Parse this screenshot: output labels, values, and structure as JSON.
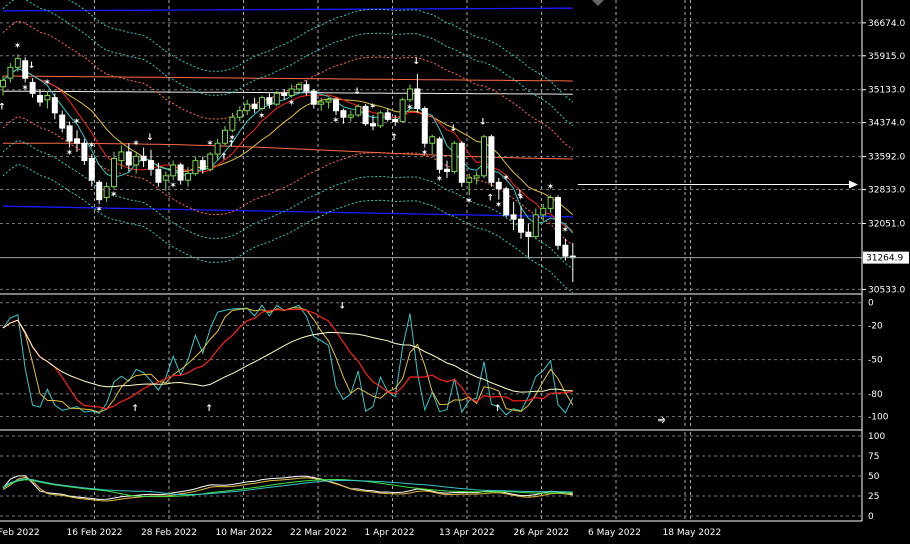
{
  "chart_data": {
    "type": "candlestick",
    "main": {
      "y_labels": [
        {
          "label": "36674.0",
          "value": 36674.0
        },
        {
          "label": "35915.0",
          "value": 35915.0
        },
        {
          "label": "35133.0",
          "value": 35133.0
        },
        {
          "label": "34374.0",
          "value": 34374.0
        },
        {
          "label": "33592.0",
          "value": 33592.0
        },
        {
          "label": "32833.0",
          "value": 32833.0
        },
        {
          "label": "32051.0",
          "value": 32051.0
        },
        {
          "label": "30533.0",
          "value": 30533.0
        }
      ],
      "current_price": {
        "label": "31264.9",
        "value": 31264.9
      },
      "ylim": [
        30450,
        37200
      ],
      "candles": [
        {
          "d": "2022-02-01",
          "o": 35200,
          "h": 35450,
          "l": 35000,
          "c": 35350
        },
        {
          "d": "2022-02-02",
          "o": 35400,
          "h": 35750,
          "l": 35300,
          "c": 35650
        },
        {
          "d": "2022-02-03",
          "o": 35650,
          "h": 35950,
          "l": 35550,
          "c": 35850
        },
        {
          "d": "2022-02-04",
          "o": 35800,
          "h": 35880,
          "l": 35300,
          "c": 35400
        },
        {
          "d": "2022-02-07",
          "o": 35300,
          "h": 35400,
          "l": 34950,
          "c": 35050
        },
        {
          "d": "2022-02-08",
          "o": 35000,
          "h": 35150,
          "l": 34750,
          "c": 34850
        },
        {
          "d": "2022-02-09",
          "o": 34900,
          "h": 35100,
          "l": 34700,
          "c": 35000
        },
        {
          "d": "2022-02-10",
          "o": 34950,
          "h": 35050,
          "l": 34450,
          "c": 34600
        },
        {
          "d": "2022-02-11",
          "o": 34550,
          "h": 34650,
          "l": 34150,
          "c": 34250
        },
        {
          "d": "2022-02-14",
          "o": 34300,
          "h": 34400,
          "l": 33800,
          "c": 33950
        },
        {
          "d": "2022-02-15",
          "o": 34000,
          "h": 34200,
          "l": 33700,
          "c": 33900
        },
        {
          "d": "2022-02-16",
          "o": 33900,
          "h": 34000,
          "l": 33400,
          "c": 33500
        },
        {
          "d": "2022-02-17",
          "o": 33550,
          "h": 33650,
          "l": 32900,
          "c": 33050
        },
        {
          "d": "2022-02-18",
          "o": 33000,
          "h": 33050,
          "l": 32500,
          "c": 32600
        },
        {
          "d": "2022-02-21",
          "o": 32650,
          "h": 33000,
          "l": 32550,
          "c": 32900
        },
        {
          "d": "2022-02-22",
          "o": 32900,
          "h": 33700,
          "l": 32850,
          "c": 33550
        },
        {
          "d": "2022-02-23",
          "o": 33500,
          "h": 33850,
          "l": 33300,
          "c": 33700
        },
        {
          "d": "2022-02-24",
          "o": 33700,
          "h": 33900,
          "l": 33250,
          "c": 33400
        },
        {
          "d": "2022-02-25",
          "o": 33400,
          "h": 33700,
          "l": 33200,
          "c": 33600
        },
        {
          "d": "2022-02-28",
          "o": 33600,
          "h": 33800,
          "l": 33350,
          "c": 33500
        },
        {
          "d": "2022-03-01",
          "o": 33500,
          "h": 33750,
          "l": 33150,
          "c": 33300
        },
        {
          "d": "2022-03-02",
          "o": 33300,
          "h": 33450,
          "l": 32900,
          "c": 33000
        },
        {
          "d": "2022-03-03",
          "o": 33050,
          "h": 33250,
          "l": 32800,
          "c": 33150
        },
        {
          "d": "2022-03-04",
          "o": 33150,
          "h": 33500,
          "l": 33050,
          "c": 33400
        },
        {
          "d": "2022-03-07",
          "o": 33400,
          "h": 33450,
          "l": 32950,
          "c": 33050
        },
        {
          "d": "2022-03-08",
          "o": 33050,
          "h": 33350,
          "l": 32900,
          "c": 33200
        },
        {
          "d": "2022-03-09",
          "o": 33200,
          "h": 33600,
          "l": 33150,
          "c": 33500
        },
        {
          "d": "2022-03-10",
          "o": 33500,
          "h": 33600,
          "l": 33200,
          "c": 33300
        },
        {
          "d": "2022-03-11",
          "o": 33300,
          "h": 33700,
          "l": 33250,
          "c": 33650
        },
        {
          "d": "2022-03-14",
          "o": 33650,
          "h": 34000,
          "l": 33500,
          "c": 33900
        },
        {
          "d": "2022-03-15",
          "o": 33900,
          "h": 34300,
          "l": 33850,
          "c": 34200
        },
        {
          "d": "2022-03-16",
          "o": 34200,
          "h": 34600,
          "l": 34150,
          "c": 34500
        },
        {
          "d": "2022-03-17",
          "o": 34500,
          "h": 34750,
          "l": 34400,
          "c": 34650
        },
        {
          "d": "2022-03-18",
          "o": 34650,
          "h": 34900,
          "l": 34550,
          "c": 34800
        },
        {
          "d": "2022-03-21",
          "o": 34800,
          "h": 34950,
          "l": 34600,
          "c": 34700
        },
        {
          "d": "2022-03-22",
          "o": 34700,
          "h": 35000,
          "l": 34650,
          "c": 34950
        },
        {
          "d": "2022-03-23",
          "o": 34950,
          "h": 35050,
          "l": 34700,
          "c": 34800
        },
        {
          "d": "2022-03-24",
          "o": 34800,
          "h": 35100,
          "l": 34750,
          "c": 35050
        },
        {
          "d": "2022-03-25",
          "o": 35050,
          "h": 35150,
          "l": 34900,
          "c": 35000
        },
        {
          "d": "2022-03-28",
          "o": 35000,
          "h": 35250,
          "l": 34950,
          "c": 35150
        },
        {
          "d": "2022-03-29",
          "o": 35150,
          "h": 35300,
          "l": 35050,
          "c": 35250
        },
        {
          "d": "2022-03-30",
          "o": 35250,
          "h": 35350,
          "l": 35000,
          "c": 35100
        },
        {
          "d": "2022-03-31",
          "o": 35100,
          "h": 35150,
          "l": 34700,
          "c": 34800
        },
        {
          "d": "2022-04-01",
          "o": 34800,
          "h": 34950,
          "l": 34650,
          "c": 34850
        },
        {
          "d": "2022-04-04",
          "o": 34850,
          "h": 34950,
          "l": 34700,
          "c": 34900
        },
        {
          "d": "2022-04-05",
          "o": 34900,
          "h": 34950,
          "l": 34550,
          "c": 34650
        },
        {
          "d": "2022-04-06",
          "o": 34650,
          "h": 34700,
          "l": 34350,
          "c": 34500
        },
        {
          "d": "2022-04-07",
          "o": 34500,
          "h": 34650,
          "l": 34400,
          "c": 34550
        },
        {
          "d": "2022-04-08",
          "o": 34550,
          "h": 34800,
          "l": 34500,
          "c": 34750
        },
        {
          "d": "2022-04-11",
          "o": 34750,
          "h": 34800,
          "l": 34300,
          "c": 34350
        },
        {
          "d": "2022-04-12",
          "o": 34350,
          "h": 34550,
          "l": 34200,
          "c": 34300
        },
        {
          "d": "2022-04-13",
          "o": 34300,
          "h": 34650,
          "l": 34250,
          "c": 34600
        },
        {
          "d": "2022-04-14",
          "o": 34600,
          "h": 34700,
          "l": 34400,
          "c": 34450
        },
        {
          "d": "2022-04-18",
          "o": 34450,
          "h": 34550,
          "l": 34300,
          "c": 34400
        },
        {
          "d": "2022-04-19",
          "o": 34400,
          "h": 34950,
          "l": 34380,
          "c": 34900
        },
        {
          "d": "2022-04-20",
          "o": 34900,
          "h": 35250,
          "l": 34850,
          "c": 35150
        },
        {
          "d": "2022-04-21",
          "o": 35150,
          "h": 35500,
          "l": 34600,
          "c": 34700
        },
        {
          "d": "2022-04-22",
          "o": 34700,
          "h": 34750,
          "l": 33800,
          "c": 33900
        },
        {
          "d": "2022-04-25",
          "o": 33900,
          "h": 34100,
          "l": 33650,
          "c": 34050
        },
        {
          "d": "2022-04-26",
          "o": 34000,
          "h": 34050,
          "l": 33200,
          "c": 33300
        },
        {
          "d": "2022-04-27",
          "o": 33300,
          "h": 33500,
          "l": 33100,
          "c": 33250
        },
        {
          "d": "2022-04-28",
          "o": 33250,
          "h": 33950,
          "l": 33200,
          "c": 33900
        },
        {
          "d": "2022-04-29",
          "o": 33900,
          "h": 33950,
          "l": 32900,
          "c": 33000
        },
        {
          "d": "2022-05-02",
          "o": 33000,
          "h": 33200,
          "l": 32700,
          "c": 33100
        },
        {
          "d": "2022-05-03",
          "o": 33100,
          "h": 33250,
          "l": 32950,
          "c": 33150
        },
        {
          "d": "2022-05-04",
          "o": 33150,
          "h": 34100,
          "l": 33100,
          "c": 34050
        },
        {
          "d": "2022-05-05",
          "o": 34050,
          "h": 34100,
          "l": 32900,
          "c": 33000
        },
        {
          "d": "2022-05-06",
          "o": 33000,
          "h": 33100,
          "l": 32600,
          "c": 32850
        },
        {
          "d": "2022-05-09",
          "o": 32850,
          "h": 32900,
          "l": 32200,
          "c": 32250
        },
        {
          "d": "2022-05-10",
          "o": 32250,
          "h": 32550,
          "l": 31900,
          "c": 32150
        },
        {
          "d": "2022-05-11",
          "o": 32150,
          "h": 32450,
          "l": 31700,
          "c": 31850
        },
        {
          "d": "2022-05-12",
          "o": 31850,
          "h": 32050,
          "l": 31250,
          "c": 31750
        },
        {
          "d": "2022-05-13",
          "o": 31750,
          "h": 32400,
          "l": 31700,
          "c": 32250
        },
        {
          "d": "2022-05-16",
          "o": 32250,
          "h": 32500,
          "l": 32100,
          "c": 32400
        },
        {
          "d": "2022-05-17",
          "o": 32400,
          "h": 32700,
          "l": 32300,
          "c": 32650
        },
        {
          "d": "2022-05-18",
          "o": 32650,
          "h": 32700,
          "l": 31450,
          "c": 31550
        },
        {
          "d": "2022-05-19",
          "o": 31550,
          "h": 31700,
          "l": 31200,
          "c": 31300
        },
        {
          "d": "2022-05-20",
          "o": 31300,
          "h": 31600,
          "l": 30700,
          "c": 31265
        }
      ]
    },
    "oscillator1": {
      "y_labels": [
        {
          "label": "0",
          "value": 0
        },
        {
          "label": "-20",
          "value": -20
        },
        {
          "label": "-50",
          "value": -50
        },
        {
          "label": "-80",
          "value": -80
        },
        {
          "label": "-100",
          "value": -100
        }
      ],
      "ylim": [
        -110,
        5
      ]
    },
    "oscillator2": {
      "y_labels": [
        {
          "label": "100",
          "value": 100
        },
        {
          "label": "75",
          "value": 75
        },
        {
          "label": "50",
          "value": 50
        },
        {
          "label": "25",
          "value": 25
        },
        {
          "label": "0",
          "value": 0
        }
      ],
      "ylim": [
        -5,
        105
      ]
    },
    "x_labels": [
      "Feb 2022",
      "16 Feb 2022",
      "28 Feb 2022",
      "10 Mar 2022",
      "22 Mar 2022",
      "1 Apr 2022",
      "13 Apr 2022",
      "26 Apr 2022",
      "6 May 2022",
      "18 May 2022"
    ],
    "grid": true,
    "colors": {
      "background": "#000000",
      "bull_candle": "#7cd350",
      "bear_candle": "#ffffff",
      "outer_band": "#1a1aff",
      "dotted_band": "#38c7c7",
      "mid_red": "#ff6a4a",
      "ma_white": "#ffffff",
      "ma_yellow": "#e0c040",
      "ma_red": "#ff2020",
      "signal_star": "#ffff00",
      "arrow_orange": "#ff9a20",
      "arrow_cyan": "#30d8e8",
      "arrow_magenta": "#ff30ff"
    }
  }
}
